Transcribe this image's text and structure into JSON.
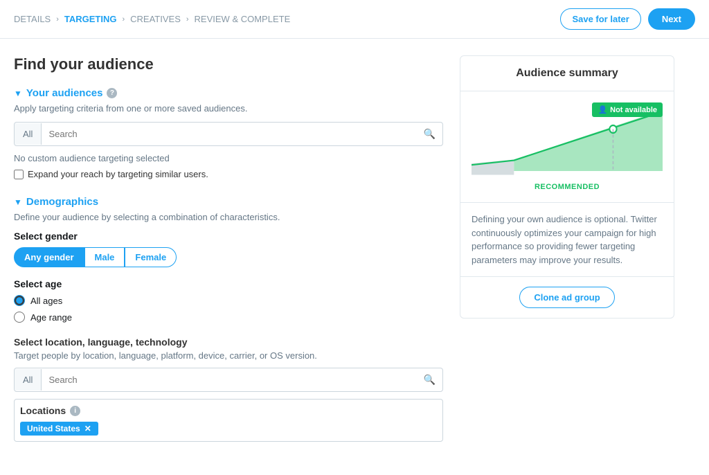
{
  "breadcrumb": {
    "items": [
      "DETAILS",
      "TARGETING",
      "CREATIVES",
      "REVIEW & COMPLETE"
    ],
    "active": "TARGETING"
  },
  "buttons": {
    "save_for_later": "Save for later",
    "next": "Next",
    "clone_ad_group": "Clone ad group"
  },
  "page": {
    "title": "Find your audience"
  },
  "your_audiences": {
    "section_title": "Your audiences",
    "description": "Apply targeting criteria from one or more saved audiences.",
    "search_tab": "All",
    "search_placeholder": "Search",
    "no_audience_text": "No custom audience targeting selected",
    "expand_label": "Expand your reach by targeting similar users."
  },
  "demographics": {
    "section_title": "Demographics",
    "description": "Define your audience by selecting a combination of characteristics.",
    "gender": {
      "label": "Select gender",
      "options": [
        "Any gender",
        "Male",
        "Female"
      ],
      "active": "Any gender"
    },
    "age": {
      "label": "Select age",
      "options": [
        "All ages",
        "Age range"
      ],
      "selected": "All ages"
    },
    "location": {
      "label": "Select location, language, technology",
      "description": "Target people by location, language, platform, device, carrier, or OS version.",
      "search_tab": "All",
      "search_placeholder": "Search",
      "locations_label": "Locations",
      "tags": [
        "United States"
      ]
    }
  },
  "audience_summary": {
    "title": "Audience summary",
    "not_available_badge": "Not available",
    "recommended_label": "RECOMMENDED",
    "description": "Defining your own audience is optional. Twitter continuously optimizes your campaign for high performance so providing fewer targeting parameters may improve your results.",
    "chart": {
      "fill_color": "#a8e6c0",
      "line_color": "#17bf63"
    }
  },
  "icons": {
    "search": "🔍",
    "info": "i",
    "person": "👤",
    "chevron_down": "▼"
  }
}
